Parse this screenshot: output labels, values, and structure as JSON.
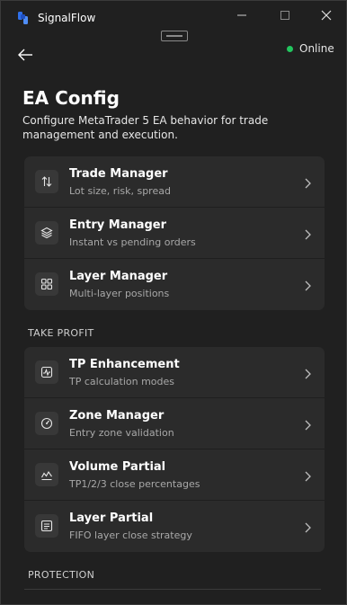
{
  "window": {
    "app_title": "SignalFlow",
    "minimize_label": "minimize",
    "maximize_label": "maximize",
    "close_label": "close"
  },
  "header": {
    "status_text": "Online",
    "status_color": "#22c55e",
    "title": "EA Config",
    "description": "Configure MetaTrader 5 EA behavior for trade management and execution."
  },
  "general": {
    "items": [
      {
        "title": "Trade Manager",
        "subtitle": "Lot size, risk, spread",
        "icon": "arrows-up-down-icon"
      },
      {
        "title": "Entry Manager",
        "subtitle": "Instant vs pending orders",
        "icon": "layers-icon"
      },
      {
        "title": "Layer Manager",
        "subtitle": "Multi-layer positions",
        "icon": "grid-icon"
      }
    ]
  },
  "take_profit": {
    "label": "TAKE PROFIT",
    "items": [
      {
        "title": "TP Enhancement",
        "subtitle": "TP calculation modes",
        "icon": "activity-icon"
      },
      {
        "title": "Zone Manager",
        "subtitle": "Entry zone validation",
        "icon": "gauge-icon"
      },
      {
        "title": "Volume Partial",
        "subtitle": "TP1/2/3 close percentages",
        "icon": "area-chart-icon"
      },
      {
        "title": "Layer Partial",
        "subtitle": "FIFO layer close strategy",
        "icon": "list-box-icon"
      }
    ]
  },
  "protection": {
    "label": "PROTECTION"
  }
}
